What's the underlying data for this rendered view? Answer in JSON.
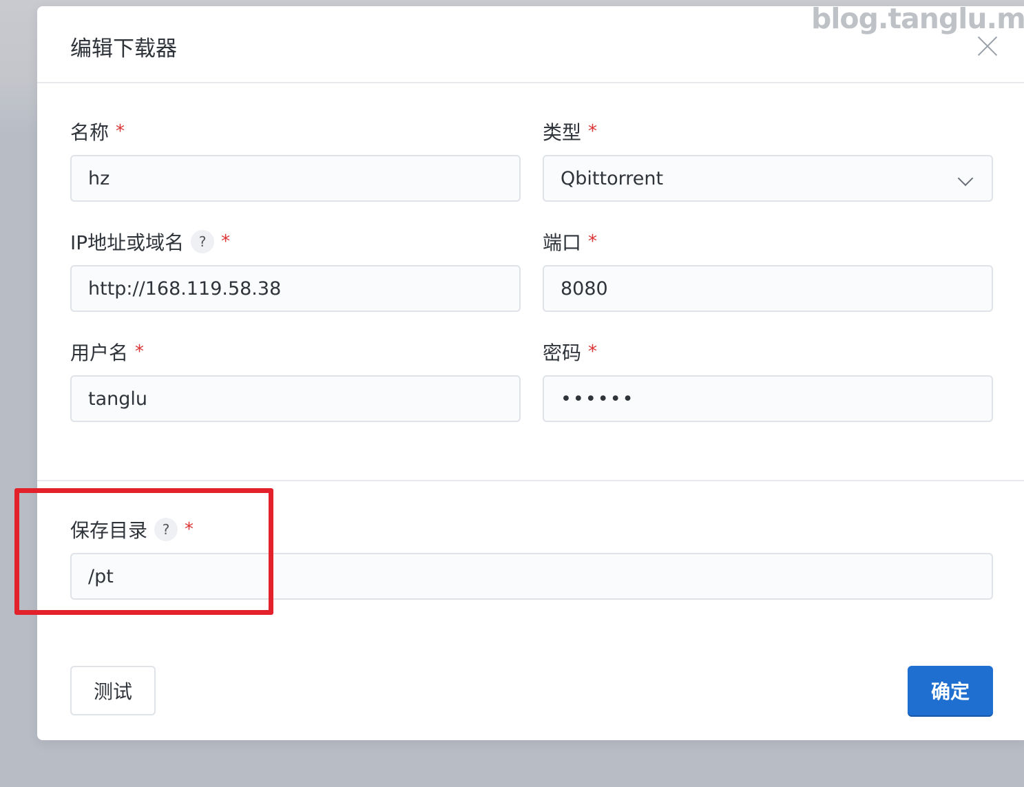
{
  "dialog": {
    "title": "编辑下载器",
    "close_icon": "close-icon"
  },
  "watermark": "blog.tanglu.me",
  "fields": {
    "name": {
      "label": "名称",
      "required_mark": "*",
      "value": "hz"
    },
    "type": {
      "label": "类型",
      "required_mark": "*",
      "value": "Qbittorrent",
      "icon": "chevron-down-icon"
    },
    "host": {
      "label": "IP地址或域名",
      "help": "?",
      "required_mark": "*",
      "value": "http://168.119.58.38"
    },
    "port": {
      "label": "端口",
      "required_mark": "*",
      "value": "8080"
    },
    "username": {
      "label": "用户名",
      "required_mark": "*",
      "value": "tanglu"
    },
    "password": {
      "label": "密码",
      "required_mark": "*",
      "value": "••••••"
    },
    "save_dir": {
      "label": "保存目录",
      "help": "?",
      "required_mark": "*",
      "value": "/pt"
    }
  },
  "buttons": {
    "test": "测试",
    "confirm": "确定"
  },
  "colors": {
    "primary": "#1f6fd0",
    "required": "#dd3333",
    "highlight": "#e3212b"
  }
}
